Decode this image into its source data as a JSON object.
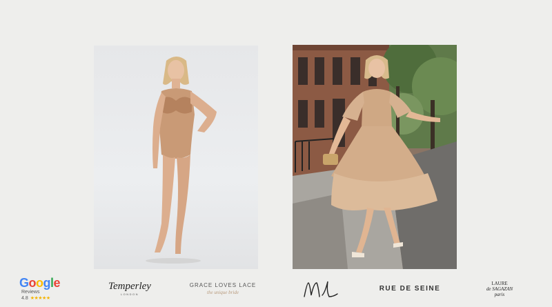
{
  "photos": {
    "left": {
      "alt": "Model in nude bodysuit"
    },
    "right": {
      "alt": "Model in beige tiered dress on street"
    }
  },
  "logos": {
    "google": {
      "word_letters": [
        "G",
        "o",
        "o",
        "g",
        "l",
        "e"
      ],
      "letter_colors": [
        "#4285F4",
        "#EA4335",
        "#FBBC05",
        "#4285F4",
        "#34A853",
        "#EA4335"
      ],
      "sub": "Reviews",
      "rating": "4.8",
      "stars": "★★★★★"
    },
    "temperley": {
      "main": "Temperley",
      "sub": "LONDON"
    },
    "grace": {
      "main": "GRACE LOVES LACE",
      "sub": "the unique bride"
    },
    "ml": {
      "main": "ML"
    },
    "rue": {
      "main": "RUE DE SEINE"
    },
    "laure": {
      "line1": "LAURE",
      "line2": "de SAGAZAN",
      "line3": "paris"
    }
  }
}
